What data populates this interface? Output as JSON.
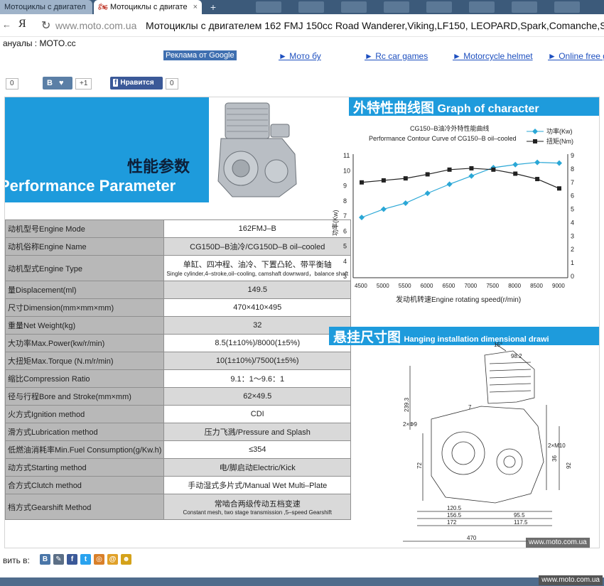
{
  "browser": {
    "tabs": [
      {
        "label": "Мотоциклы с двигател"
      },
      {
        "label": "Мотоциклы с двигате"
      }
    ],
    "close_glyph": "×",
    "new_tab_glyph": "+",
    "nav_glyph": "←",
    "yandex_logo": "Я",
    "reload_glyph": "↻",
    "domain": "www.moto.com.ua",
    "page_title": "Мотоциклы с двигателем 162 FMJ 150cc Road Wanderer,Viking,LF150, LEOPARD,Spark,Comanche,Sli",
    "bookmark": "ануалы : MOTO.cc"
  },
  "ads": {
    "google_label": "Реклама от Google",
    "links": [
      "► Мото бу",
      "► Rc car games",
      "► Motorcycle helmet",
      "► Online free g"
    ]
  },
  "social": {
    "first_count": "0",
    "vk_label": "В",
    "vk_count": "+1",
    "fb_label": "Нравится",
    "fb_count": "0"
  },
  "spec_sheet": {
    "heading_cn": "性能参数",
    "heading_en": "Performance Parameter",
    "rows": [
      {
        "key": "动机型号Engine Mode",
        "value": "162FMJ–B"
      },
      {
        "key": "动机俗称Engine Name",
        "value": "CG150D–B油冷/CG150D–B oil–cooled"
      },
      {
        "key": "动机型式Engine Type",
        "value": "单缸、四冲程、油冷、下置凸轮、带平衡轴",
        "value2": "Single cylinder,4–stroke,oil–cooling, camshaft downward，balance shaft"
      },
      {
        "key": "量Displacement(ml)",
        "value": "149.5"
      },
      {
        "key": "尺寸Dimension(mm×mm×mm)",
        "value": "470×410×495"
      },
      {
        "key": "重量Net Weight(kg)",
        "value": "32"
      },
      {
        "key": "大功率Max.Power(kw/r/min)",
        "value": "8.5(1±10%)/8000(1±5%)"
      },
      {
        "key": "大扭矩Max.Torque (N.m/r/min)",
        "value": "10(1±10%)/7500(1±5%)"
      },
      {
        "key": "缩比Compression Ratio",
        "value": "9.1：1～9.6：1"
      },
      {
        "key": "径与行程Bore and Stroke(mm×mm)",
        "value": "62×49.5"
      },
      {
        "key": "火方式Ignition method",
        "value": "CDI"
      },
      {
        "key": "滑方式Lubrication method",
        "value": "压力飞溅/Pressure and Splash"
      },
      {
        "key": "低燃油消耗率Min.Fuel Consumption(g/Kw.h)",
        "value": "≤354"
      },
      {
        "key": "动方式Starting method",
        "value": "电/脚启动Electric/Kick"
      },
      {
        "key": "合方式Clutch method",
        "value": "手动湿式多片式/Manual Wet Multi–Plate"
      },
      {
        "key": "档方式Gearshift Method",
        "value": "常啮合两级传动五档变速",
        "value2": "Constant mesh, two stage transmission ,5–speed Gearshift"
      }
    ]
  },
  "graph_banner": {
    "cn": "外特性曲线图",
    "en": "Graph of character"
  },
  "hanging_banner": {
    "cn": "悬挂尺寸图",
    "en": "Hanging installation dimensional drawi"
  },
  "chart_data": {
    "type": "line",
    "title": "CG150–B油冷外特性能曲线",
    "subtitle": "Performance Contour Curve of CG150–B oil–cooled",
    "xlabel": "发动机转速Engine rotating speed(r/min)",
    "ylabel": "功率(Kw)",
    "x": [
      4500,
      5000,
      5500,
      6000,
      6500,
      7000,
      7500,
      8000,
      8500,
      9000
    ],
    "ylim_left": [
      3,
      11
    ],
    "ylim_right": [
      0,
      9
    ],
    "left_ticks": [
      3,
      4,
      5,
      6,
      7,
      8,
      9,
      10,
      11
    ],
    "right_ticks": [
      0,
      1,
      2,
      3,
      4,
      5,
      6,
      7,
      8,
      9
    ],
    "series": [
      {
        "name": "功率(Kw)",
        "axis": "left",
        "color": "#2aa7d6",
        "marker": "diamond",
        "values": [
          6.9,
          7.45,
          7.85,
          8.5,
          9.1,
          9.65,
          10.2,
          10.4,
          10.55,
          10.5
        ]
      },
      {
        "name": "扭矩(Nm)",
        "axis": "right",
        "color": "#222222",
        "marker": "square",
        "values": [
          7.0,
          7.15,
          7.3,
          7.6,
          7.95,
          8.05,
          7.95,
          7.65,
          7.25,
          6.55
        ]
      }
    ],
    "legend_position": "top-right",
    "grid": false
  },
  "drawing_dims": [
    "15°",
    "98.2",
    "239.3",
    "2×Φ9",
    "2×M10",
    "120.5",
    "156.5",
    "172",
    "95.5",
    "117.5",
    "470",
    "72",
    "92",
    "36",
    "7"
  ],
  "watermark": "www.moto.com.ua",
  "share": {
    "label": "вить в:",
    "icons": [
      {
        "name": "vk",
        "glyph": "B",
        "color": "#4a76a8"
      },
      {
        "name": "pencil",
        "glyph": "✎",
        "color": "#5c6f86"
      },
      {
        "name": "facebook",
        "glyph": "f",
        "color": "#3b5998"
      },
      {
        "name": "twitter",
        "glyph": "t",
        "color": "#2aa3ef"
      },
      {
        "name": "odnoklassniki",
        "glyph": "◎",
        "color": "#d9802a"
      },
      {
        "name": "mailru",
        "glyph": "@",
        "color": "#e0a12a"
      },
      {
        "name": "people",
        "glyph": "☻",
        "color": "#d4a21a"
      }
    ]
  },
  "footer_watermark": "www.moto.com.ua"
}
